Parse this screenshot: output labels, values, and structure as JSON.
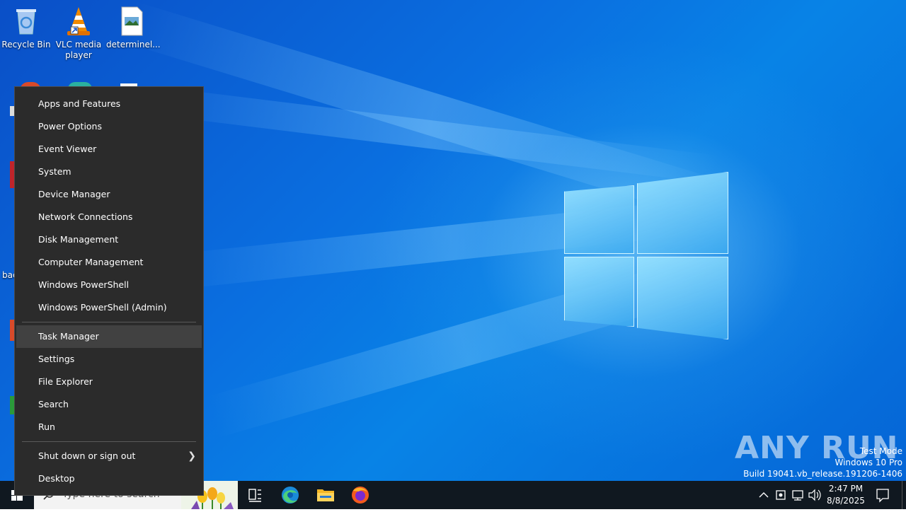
{
  "desktop": {
    "icons": [
      {
        "label": "Recycle Bin"
      },
      {
        "label": "VLC media player"
      },
      {
        "label": "determinel..."
      }
    ],
    "partial_label": "bac"
  },
  "menu": {
    "group1": [
      "Apps and Features",
      "Power Options",
      "Event Viewer",
      "System",
      "Device Manager",
      "Network Connections",
      "Disk Management",
      "Computer Management",
      "Windows PowerShell",
      "Windows PowerShell (Admin)"
    ],
    "group2": [
      "Task Manager",
      "Settings",
      "File Explorer",
      "Search",
      "Run"
    ],
    "group3": [
      "Shut down or sign out",
      "Desktop"
    ],
    "hovered": "Task Manager"
  },
  "taskbar": {
    "search_placeholder": "Type here to search",
    "time": "2:47 PM",
    "date": "8/8/2025"
  },
  "watermark": {
    "text": "ANY RUN"
  },
  "build_info": {
    "line1": "Test Mode",
    "line2": "Windows 10 Pro",
    "line3": "Build 19041.vb_release.191206-1406"
  },
  "colors": {
    "menu_bg": "#2b2b2b",
    "menu_hover": "#414141",
    "taskbar_bg": "#101820",
    "desktop_blue": "#0a6fe0"
  }
}
